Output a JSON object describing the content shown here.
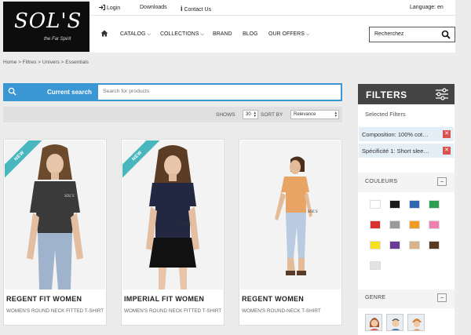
{
  "header": {
    "logo_text": "SOL'S",
    "logo_tagline": "the Far Spirit",
    "top_links": [
      "Login",
      "Downloads",
      "Contact Us"
    ],
    "language": "Language: en",
    "nav": [
      "CATALOG",
      "COLLECTIONS",
      "BRAND",
      "BLOG",
      "OUR OFFERS"
    ],
    "search_value": "Recherchez"
  },
  "breadcrumb": "Home > Filtres > Univers > Essentials",
  "current_search": {
    "label": "Current search",
    "placeholder": "Search for products"
  },
  "sortbar": {
    "shows_label": "SHOWS",
    "shows_value": "30",
    "sort_label": "SORT BY",
    "sort_value": "Relevance"
  },
  "products": [
    {
      "name": "REGENT FIT WOMEN",
      "desc": "WOMEN'S ROUND NECK FITTED T-SHIRT",
      "badge": "NEW",
      "shirt": "#3a3a3a"
    },
    {
      "name": "IMPERIAL FIT WOMEN",
      "desc": "WOMEN'S ROUND NECK FITTED T-SHIRT",
      "badge": "NEW",
      "shirt": "#232842"
    },
    {
      "name": "REGENT WOMEN",
      "desc": "WOMEN'S ROUND-NECK T-SHIRT",
      "badge": "",
      "shirt": "#e8a464"
    }
  ],
  "product_logo": "SOL'S",
  "filters": {
    "title": "FILTERS",
    "selected_title": "Selected Filters",
    "selected": [
      "Composition: 100% cot…",
      "Spécificité 1: Short slee…"
    ],
    "couleurs_title": "COULEURS",
    "genre_title": "GENRE",
    "swatches": [
      "#ffffff",
      "#1c1c1c",
      "#2f67b1",
      "#2e9e50",
      "#d93030",
      "#9a9a9a",
      "#f19b24",
      "#f07fb0",
      "#f6e21a",
      "#6a3b99",
      "#d6b48a",
      "#5b3a1f",
      "#e3e3e3"
    ]
  },
  "colors": {
    "accent": "#3b97d3",
    "filter_head": "#444444",
    "ribbon": "#47b6bd"
  }
}
